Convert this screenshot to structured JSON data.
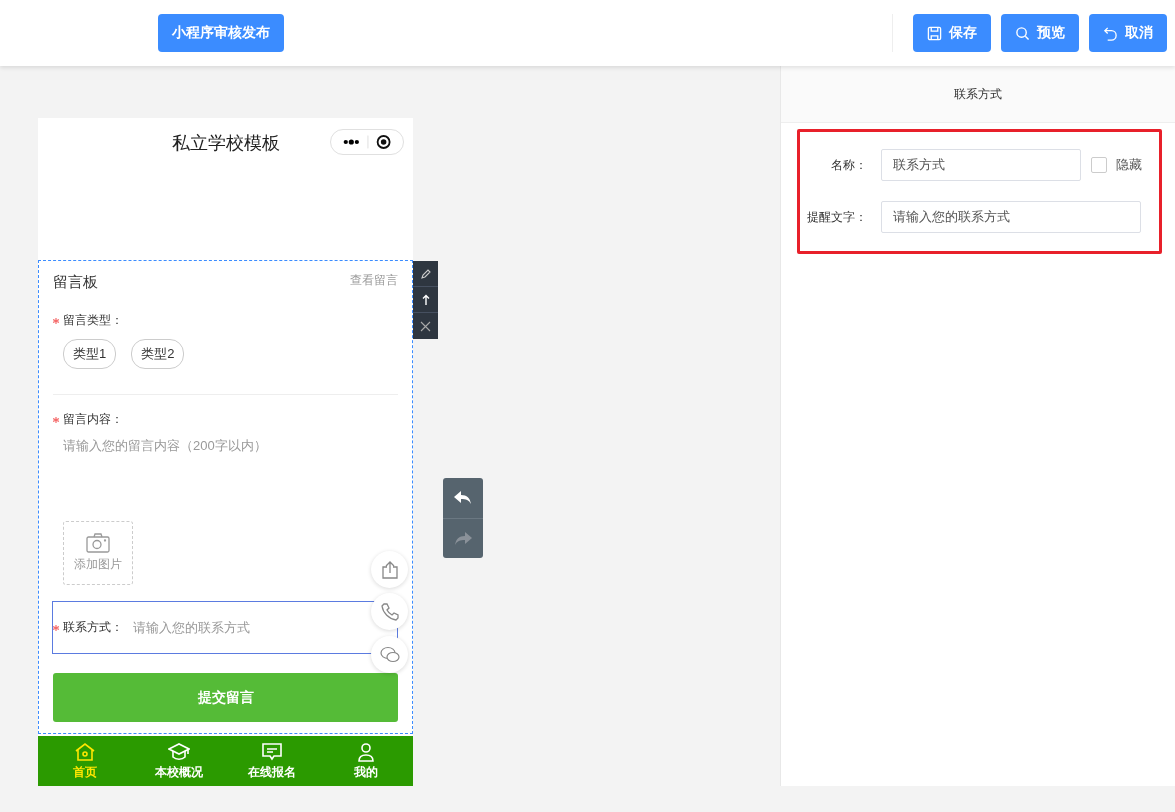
{
  "toolbar": {
    "publish_button": "小程序审核发布",
    "buttons": [
      {
        "kind": "save",
        "label": "保存"
      },
      {
        "kind": "preview",
        "label": "预览"
      },
      {
        "kind": "cancel",
        "label": "取消"
      }
    ]
  },
  "phone": {
    "title": "私立学校模板",
    "message_board": {
      "title": "留言板",
      "view_link": "查看留言",
      "type_field": {
        "label": "留言类型：",
        "required": true,
        "options": [
          {
            "label": "类型1",
            "selected": false
          },
          {
            "label": "类型2",
            "selected": false
          }
        ]
      },
      "content_field": {
        "label": "留言内容：",
        "required": true,
        "placeholder": "请输入您的留言内容（200字以内）"
      },
      "upload": {
        "label": "添加图片"
      },
      "contact_field": {
        "label": "联系方式：",
        "required": true,
        "placeholder": "请输入您的联系方式"
      },
      "submit_button": "提交留言"
    },
    "tab_bar": [
      {
        "kind": "home",
        "label": "首页",
        "selected": true
      },
      {
        "kind": "school",
        "label": "本校概况",
        "selected": false
      },
      {
        "kind": "message",
        "label": "在线报名",
        "selected": false
      },
      {
        "kind": "user",
        "label": "我的",
        "selected": false
      }
    ]
  },
  "history": {
    "undo": {
      "disabled": false
    },
    "redo": {
      "disabled": true
    }
  },
  "settings": {
    "title": "联系方式",
    "name_field": {
      "label": "名称：",
      "value": "联系方式"
    },
    "hide_checkbox": {
      "label": "隐藏",
      "checked": false
    },
    "hint_field": {
      "label": "提醒文字：",
      "value": "请输入您的联系方式"
    }
  }
}
